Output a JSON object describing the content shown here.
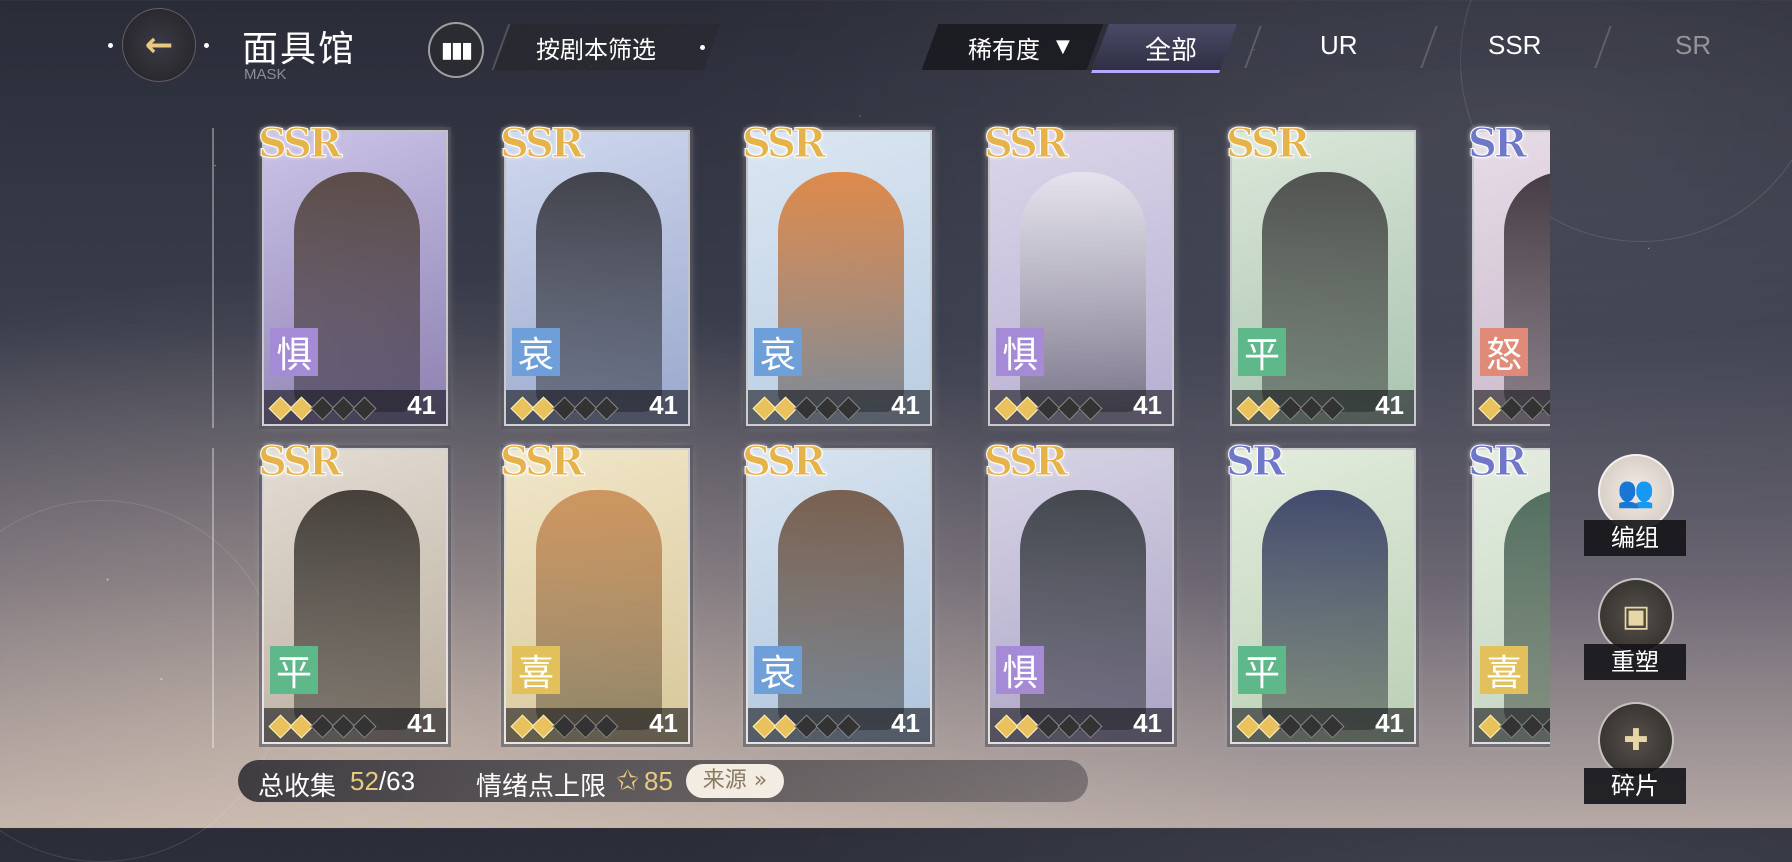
{
  "header": {
    "title": "面具馆",
    "subtitle": "MASK",
    "filter_label": "按剧本筛选",
    "rarity_dropdown_label": "稀有度",
    "tabs": [
      {
        "label": "全部",
        "active": true
      },
      {
        "label": "UR",
        "active": false
      },
      {
        "label": "SSR",
        "active": false
      },
      {
        "label": "SR",
        "active": false
      }
    ]
  },
  "cards": [
    {
      "rarity": "SSR",
      "emotion": "惧",
      "emotion_color": "#a58bd6",
      "level": "41",
      "stars": 2,
      "art": [
        "#cbc4e8",
        "#8c7fb0"
      ],
      "figure": "#4a3a2e"
    },
    {
      "rarity": "SSR",
      "emotion": "哀",
      "emotion_color": "#6f9fd8",
      "level": "41",
      "stars": 2,
      "art": [
        "#cfd8ee",
        "#9aa7cc"
      ],
      "figure": "#2a2a30"
    },
    {
      "rarity": "SSR",
      "emotion": "哀",
      "emotion_color": "#6f9fd8",
      "level": "41",
      "stars": 2,
      "art": [
        "#dbe6f2",
        "#b9cde2"
      ],
      "figure": "#e07a2e"
    },
    {
      "rarity": "SSR",
      "emotion": "惧",
      "emotion_color": "#a58bd6",
      "level": "41",
      "stars": 2,
      "art": [
        "#dcd6ea",
        "#b6aed0"
      ],
      "figure": "#e8e6ef"
    },
    {
      "rarity": "SSR",
      "emotion": "平",
      "emotion_color": "#5fb889",
      "level": "41",
      "stars": 2,
      "art": [
        "#dbe7da",
        "#a9c3b0"
      ],
      "figure": "#3a3a3a"
    },
    {
      "rarity": "SR",
      "emotion": "怒",
      "emotion_color": "#e08a7a",
      "level": "",
      "stars": 1,
      "art": [
        "#e6dce6",
        "#c9b7c9"
      ],
      "figure": "#2a2228"
    },
    {
      "rarity": "SSR",
      "emotion": "平",
      "emotion_color": "#5fb889",
      "level": "41",
      "stars": 2,
      "art": [
        "#e4ddd4",
        "#b9ad9e"
      ],
      "figure": "#2c2622"
    },
    {
      "rarity": "SSR",
      "emotion": "喜",
      "emotion_color": "#e2c15c",
      "level": "41",
      "stars": 2,
      "art": [
        "#f0e6c8",
        "#d8c79a"
      ],
      "figure": "#c9894e"
    },
    {
      "rarity": "SSR",
      "emotion": "哀",
      "emotion_color": "#6f9fd8",
      "level": "41",
      "stars": 2,
      "art": [
        "#d8e4f0",
        "#aec4dc"
      ],
      "figure": "#6a4a34"
    },
    {
      "rarity": "SSR",
      "emotion": "惧",
      "emotion_color": "#a58bd6",
      "level": "41",
      "stars": 2,
      "art": [
        "#d8d4e6",
        "#aaa3c4"
      ],
      "figure": "#2a3034"
    },
    {
      "rarity": "SR",
      "emotion": "平",
      "emotion_color": "#5fb889",
      "level": "41",
      "stars": 2,
      "art": [
        "#e3ecdd",
        "#b9cfb4"
      ],
      "figure": "#27305a"
    },
    {
      "rarity": "SR",
      "emotion": "喜",
      "emotion_color": "#e2c15c",
      "level": "",
      "stars": 1,
      "art": [
        "#e4ece0",
        "#c0d4bd"
      ],
      "figure": "#3a5a4a"
    }
  ],
  "side_buttons": [
    {
      "label": "编组",
      "icon": "group-icon"
    },
    {
      "label": "重塑",
      "icon": "reshape-icon"
    },
    {
      "label": "碎片",
      "icon": "puzzle-icon"
    }
  ],
  "footer": {
    "collection_label": "总收集",
    "collected": "52",
    "total": "/63",
    "emotion_limit_label": "情绪点上限",
    "emotion_limit_value": "85",
    "source_label": "来源 »"
  }
}
